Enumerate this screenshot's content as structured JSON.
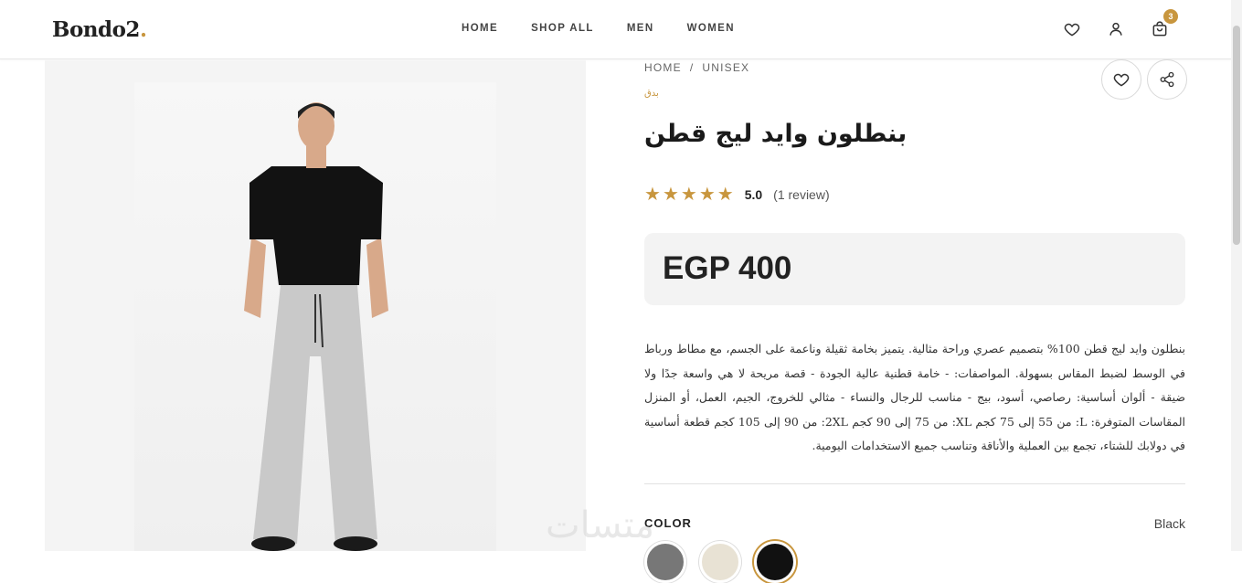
{
  "header": {
    "logo_text": "Bondo2",
    "logo_dot": ".",
    "nav": [
      "HOME",
      "SHOP ALL",
      "MEN",
      "WOMEN"
    ],
    "cart_count": "3",
    "icons": [
      "heart-icon",
      "user-icon",
      "cart-icon"
    ]
  },
  "breadcrumb": {
    "home": "HOME",
    "separator": "/",
    "current": "UNISEX"
  },
  "product": {
    "brand": "بدق",
    "title": "بنطلون وايد ليج قطن",
    "rating_value": "5.0",
    "rating_stars": 5,
    "review_count": "(1 review)",
    "price": "EGP 400",
    "description": "بنطلون وايد ليج قطن 100% بتصميم عصري وراحة مثالية. يتميز بخامة ثقيلة وناعمة على الجسم، مع مطاط ورباط في الوسط لضبط المقاس بسهولة. المواصفات: - خامة قطنية عالية الجودة - قصة مريحة لا هي واسعة جدًا ولا ضيقة - ألوان أساسية: رصاصي، أسود، بيج - مناسب للرجال والنساء - مثالي للخروج، الجيم، العمل، أو المنزل المقاسات المتوفرة: L: من 55 إلى 75 كجم XL: من 75 إلى 90 كجم 2XL: من 90 إلى 105 كجم قطعة أساسية في دولابك للشتاء، تجمع بين العملية والأناقة وتناسب جميع الاستخدامات اليومية.",
    "color_label": "COLOR",
    "selected_color": "Black",
    "swatches": [
      "#777777",
      "#e8e2d4",
      "#111111"
    ]
  },
  "colors": {
    "accent": "#c8963e",
    "price_bg": "#f3f3f3"
  },
  "watermark": "متسات"
}
